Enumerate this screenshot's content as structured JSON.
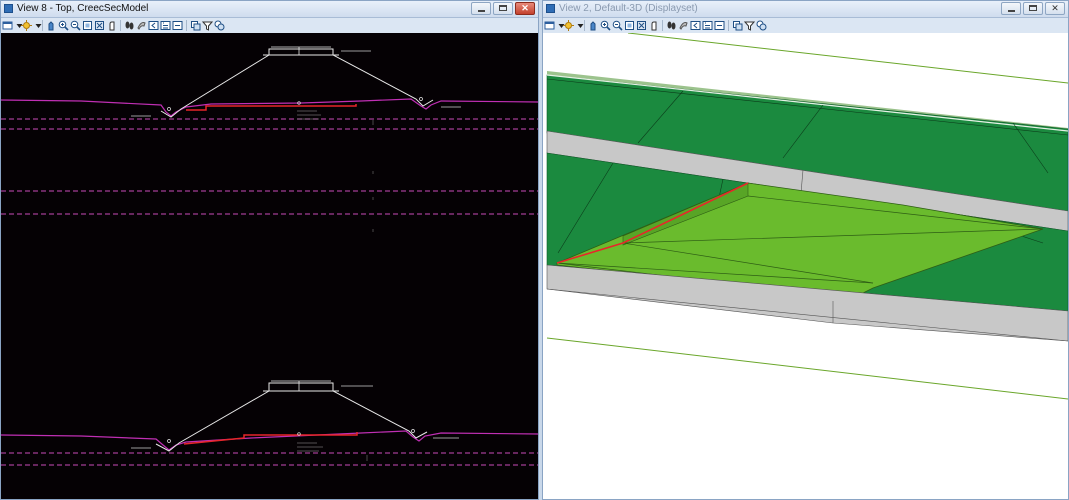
{
  "views": [
    {
      "id": "view8",
      "title": "View 8 - Top, CreecSecModel",
      "toolbar_icons": [
        "view-attributes-icon",
        "dropdown-arrow-icon",
        "display-style-icon",
        "dropdown-arrow-icon",
        "pan-icon",
        "zoom-in-icon",
        "zoom-out-icon",
        "window-area-icon",
        "fit-view-icon",
        "rotate-view-icon",
        "walk-icon",
        "copy-view-icon",
        "view-previous-icon",
        "view-next-icon",
        "camera-icon",
        "clip-volume-icon",
        "view-group-icon"
      ],
      "window_buttons": [
        "minimize",
        "maximize",
        "close"
      ]
    },
    {
      "id": "view2",
      "title": "View 2, Default-3D (Displayset)",
      "toolbar_icons": [
        "view-attributes-icon",
        "dropdown-arrow-icon",
        "display-style-icon",
        "dropdown-arrow-icon",
        "pan-icon",
        "zoom-in-icon",
        "zoom-out-icon",
        "window-area-icon",
        "fit-view-icon",
        "rotate-view-icon",
        "walk-icon",
        "copy-view-icon",
        "view-previous-icon",
        "view-next-icon",
        "camera-icon",
        "clip-volume-icon",
        "view-group-icon"
      ],
      "window_buttons": [
        "minimize",
        "maximize",
        "close"
      ]
    }
  ],
  "colors": {
    "cad_background": "#050104",
    "road_line": "#e9e9e9",
    "ground_line": "#c02fb4",
    "existing_ground": "#e8262a",
    "dashed_magenta": "#c94ab8",
    "embankment_dark": "#1b8a3f",
    "embankment_light": "#6abb2d",
    "shoulder_gray": "#c8c8c8",
    "green_guide": "#6aa62a"
  }
}
